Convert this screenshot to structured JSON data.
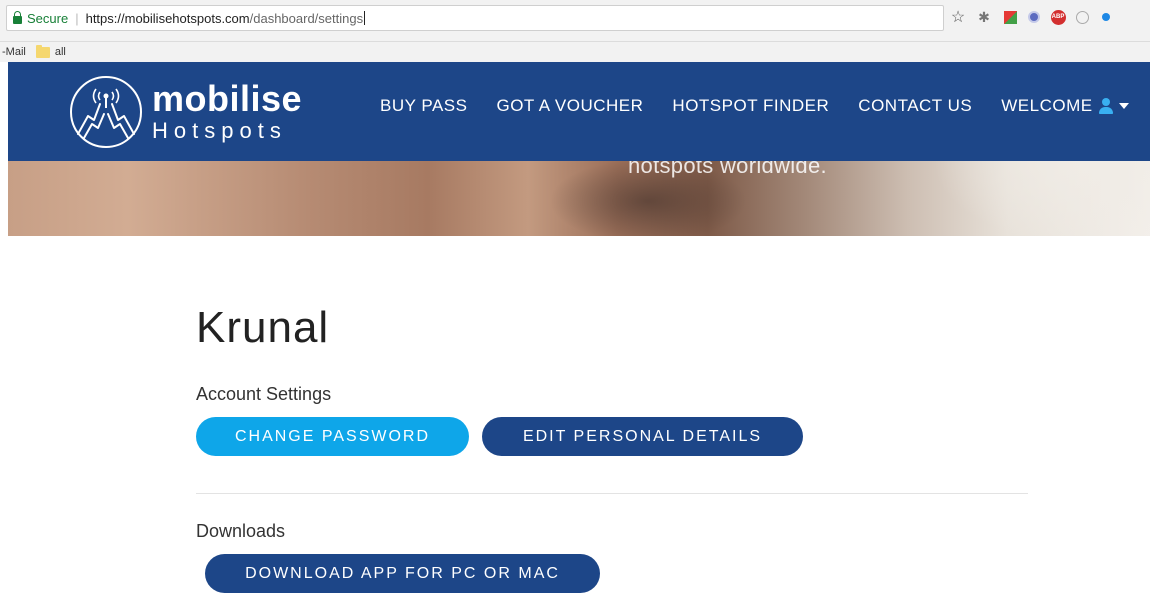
{
  "browser": {
    "secure_label": "Secure",
    "url_host": "https://mobilisehotspots.com",
    "url_path": "/dashboard/settings",
    "bookmarks": [
      {
        "label": "-Mail"
      },
      {
        "label": "all"
      }
    ],
    "extensions": [
      "star-icon",
      "bug-icon",
      "color-square-icon",
      "blue-circle-icon",
      "abp-icon",
      "circle-outline-icon",
      "blue-dot-icon"
    ],
    "abp_label": "ABP"
  },
  "header": {
    "logo_name": "mobilise",
    "logo_sub": "Hotspots",
    "nav": {
      "buy_pass": "BUY PASS",
      "voucher": "GOT A VOUCHER",
      "finder": "HOTSPOT FINDER",
      "contact": "CONTACT US",
      "welcome": "WELCOME"
    },
    "brand_color": "#1d4688",
    "accent_color": "#0ea6e9"
  },
  "hero": {
    "text": "hotspots worldwide."
  },
  "main": {
    "user_name": "Krunal",
    "account_settings": {
      "title": "Account Settings",
      "change_password": "CHANGE PASSWORD",
      "edit_details": "EDIT PERSONAL DETAILS"
    },
    "downloads": {
      "title": "Downloads",
      "download_app": "DOWNLOAD APP FOR PC OR MAC"
    }
  }
}
